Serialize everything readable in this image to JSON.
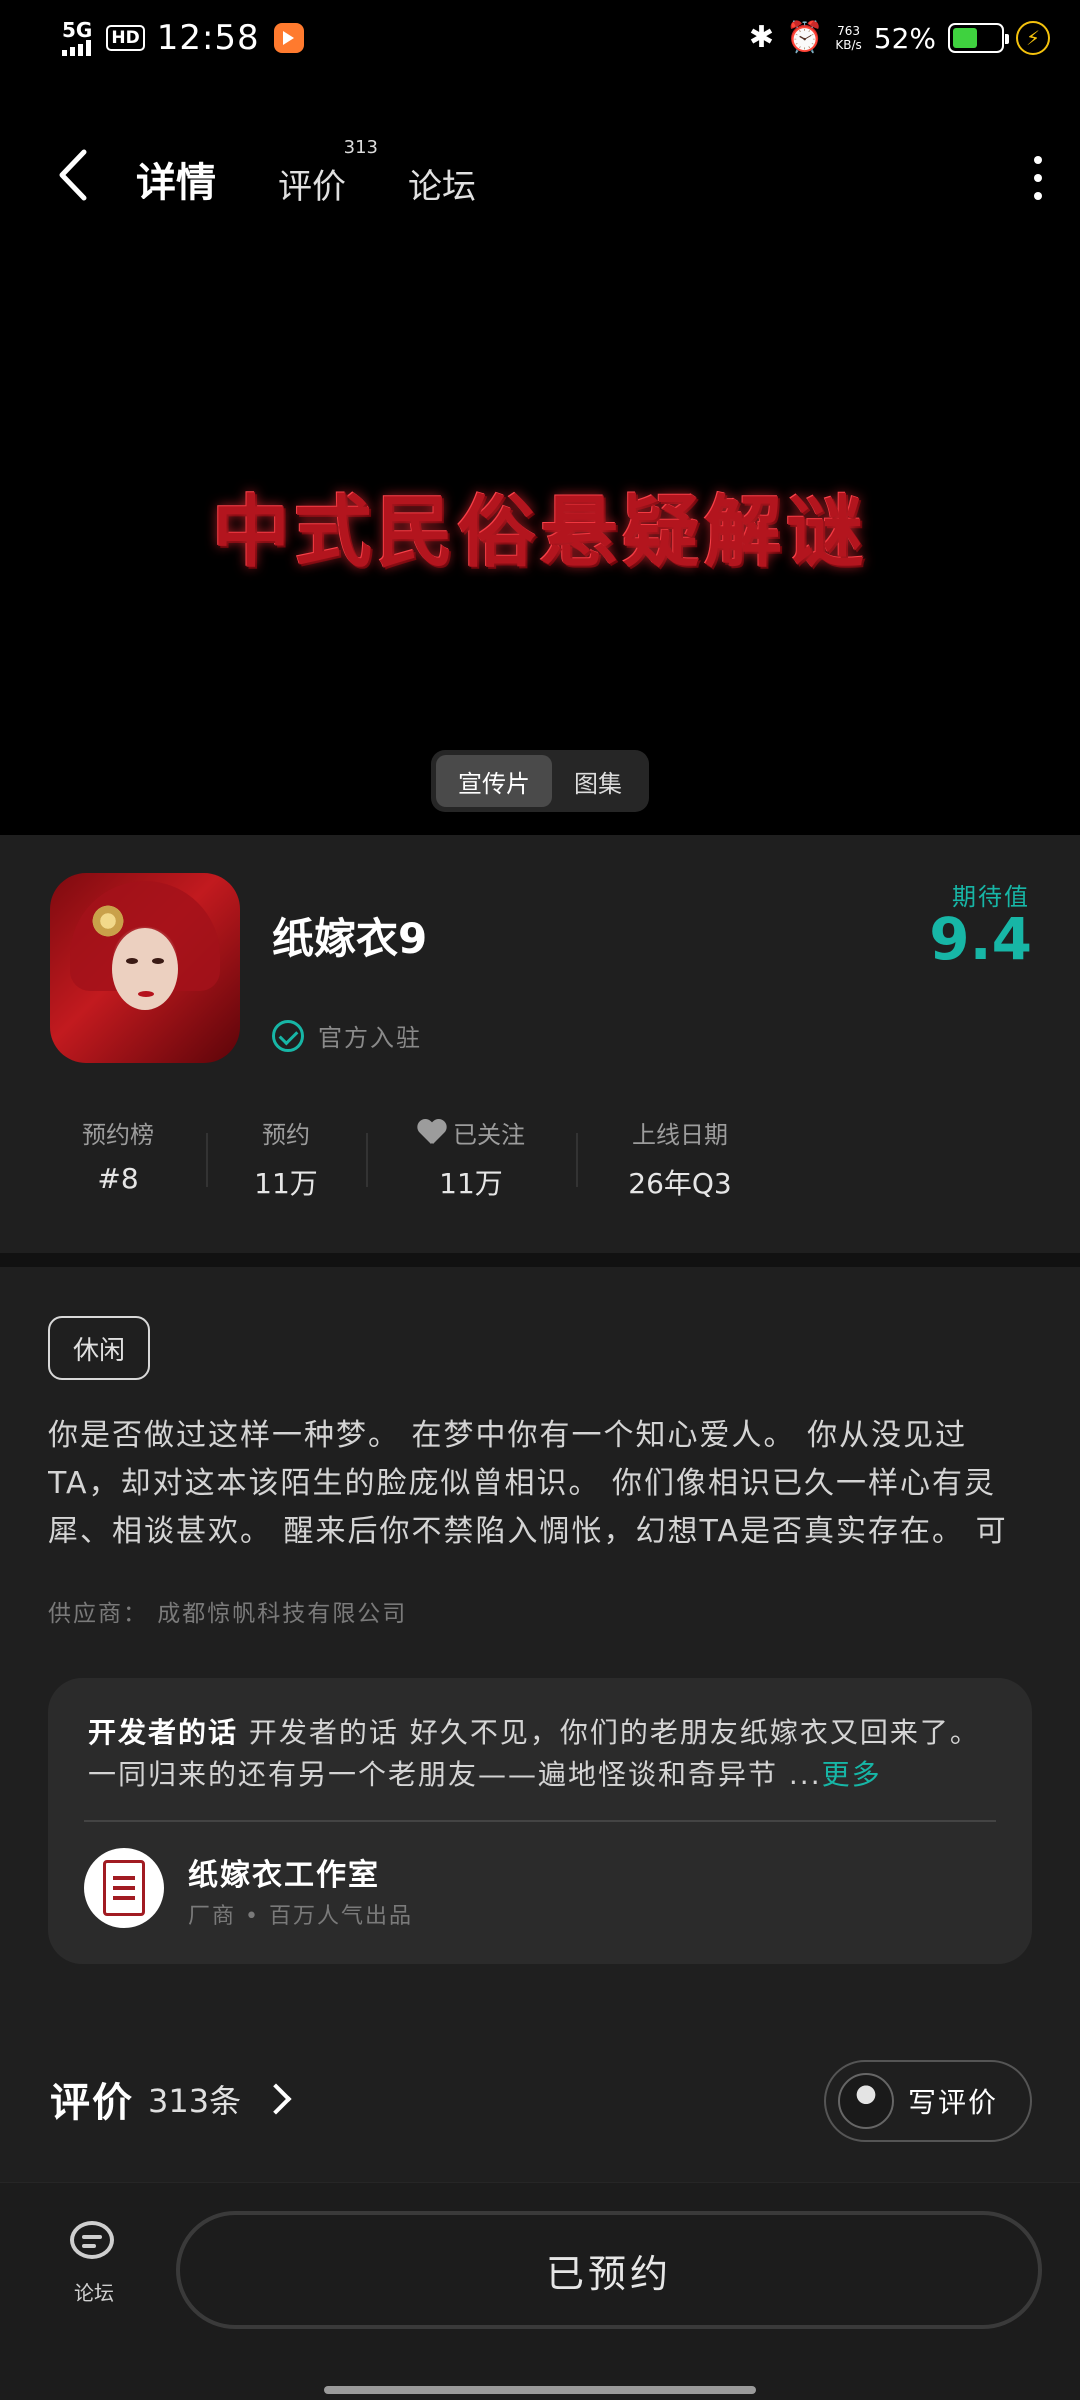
{
  "status_bar": {
    "network": "5G",
    "hd": "HD",
    "time": "12:58",
    "bluetooth_glyph": "✱",
    "alarm_glyph": "⏰",
    "speed_value": "763",
    "speed_unit": "KB/s",
    "battery": "52%",
    "battery_level": 0.52,
    "charge_glyph": "⚡",
    "battery_color": "#3fd23f"
  },
  "nav": {
    "tabs": [
      {
        "label": "详情",
        "active": true
      },
      {
        "label": "评价",
        "count": "313"
      },
      {
        "label": "论坛"
      }
    ]
  },
  "video": {
    "title": "中式民俗悬疑解谜",
    "toggle": [
      "宣传片",
      "图集"
    ]
  },
  "game": {
    "name": "纸嫁衣9",
    "official_label": "官方入驻",
    "expect_label": "期待值",
    "expect_score": "9.4",
    "accent_color": "#17b6a6"
  },
  "stats": [
    {
      "label": "预约榜",
      "value": "#8"
    },
    {
      "label": "预约",
      "value": "11万"
    },
    {
      "label": "已关注",
      "value": "11万",
      "icon": "heart-icon"
    },
    {
      "label": "上线日期",
      "value": "26年Q3"
    }
  ],
  "tags": [
    "休闲"
  ],
  "description": "你是否做过这样一种梦。 在梦中你有一个知心爱人。 你从没见过TA，却对这本该陌生的脸庞似曾相识。 你们像相识已久一样心有灵犀、相谈甚欢。 醒来后你不禁陷入惆怅，幻想TA是否真实存在。 可是当梦…",
  "supplier": "供应商： 成都惊帆科技有限公司",
  "developer_note": {
    "heading": "开发者的话",
    "text": " 开发者的话 好久不见，你们的老朋友纸嫁衣又回来了。 一同归来的还有另一个老朋友——遍地怪谈和奇异节 ...",
    "more": "更多",
    "studio_name": "纸嫁衣工作室",
    "studio_sub": "厂商 • 百万人气出品"
  },
  "reviews": {
    "label": "评价",
    "count": "313条",
    "write_label": "写评价"
  },
  "bottom": {
    "forum_label": "论坛",
    "reserve_label": "已预约"
  }
}
